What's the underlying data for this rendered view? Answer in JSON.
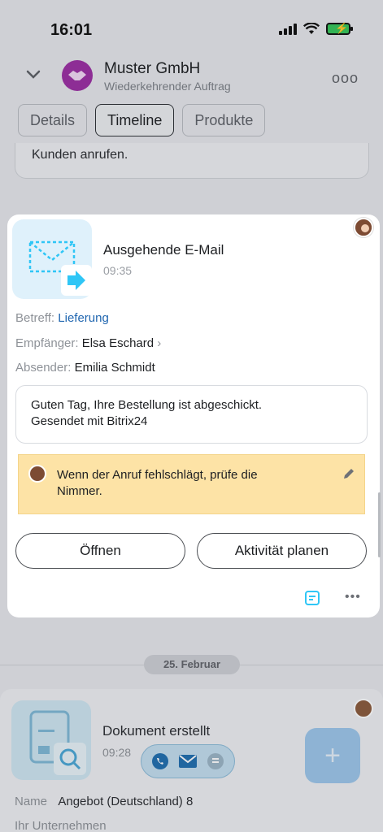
{
  "status_bar": {
    "time": "16:01"
  },
  "header": {
    "company_name": "Muster GmbH",
    "subtitle": "Wiederkehrender Auftrag",
    "more_label": "ooo"
  },
  "tabs": [
    {
      "label": "Details",
      "active": false
    },
    {
      "label": "Timeline",
      "active": true
    },
    {
      "label": "Produkte",
      "active": false
    }
  ],
  "previous_item": {
    "text": "Kunden anrufen."
  },
  "activity": {
    "title": "Ausgehende E-Mail",
    "time": "09:35",
    "subject_label": "Betreff:",
    "subject_value": "Lieferung",
    "recipient_label": "Empfänger:",
    "recipient_value": "Elsa Eschard",
    "recipient_chevron": "›",
    "sender_label": "Absender:",
    "sender_value": "Emilia Schmidt",
    "message_line1": "Guten Tag, Ihre Bestellung ist abgeschickt.",
    "message_line2": "Gesendet mit Bitrix24",
    "note_text": "Wenn der Anruf fehlschlägt, prüfe die Nimmer.",
    "open_button": "Öffnen",
    "plan_button": "Aktivität planen",
    "more_label": "•••"
  },
  "date_divider": "25. Februar",
  "document_item": {
    "title": "Dokument erstellt",
    "time": "09:28",
    "name_label": "Name",
    "name_value": "Angebot (Deutschland) 8",
    "company_label": "Ihr Unternehmen"
  },
  "fab_label": "+",
  "colors": {
    "accent_blue": "#2066b0",
    "icon_blue": "#2fc6f6",
    "note_yellow": "#fde3a6",
    "company_avatar": "#9b2ea3",
    "battery_green": "#35c759"
  }
}
